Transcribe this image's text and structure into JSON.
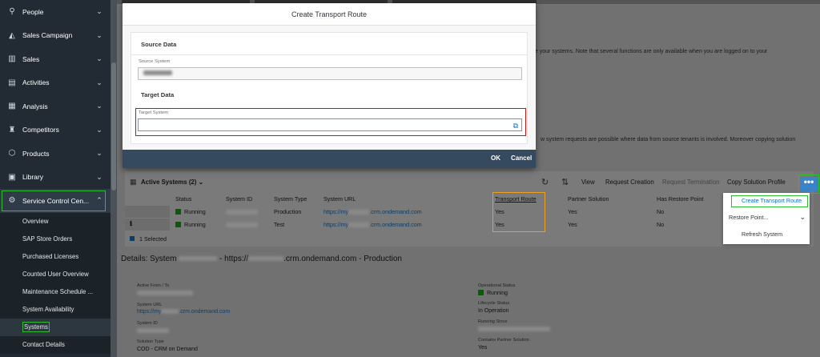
{
  "sidebar": {
    "items": [
      {
        "label": "People",
        "icon": "person-icon",
        "glyph": "⚲"
      },
      {
        "label": "Sales Campaign",
        "icon": "megaphone-icon",
        "glyph": "◭"
      },
      {
        "label": "Sales",
        "icon": "sales-chart-icon",
        "glyph": "▥"
      },
      {
        "label": "Activities",
        "icon": "activities-icon",
        "glyph": "▤"
      },
      {
        "label": "Analysis",
        "icon": "analysis-icon",
        "glyph": "▦"
      },
      {
        "label": "Competitors",
        "icon": "competitors-icon",
        "glyph": "♜"
      },
      {
        "label": "Products",
        "icon": "products-icon",
        "glyph": "⬡"
      },
      {
        "label": "Library",
        "icon": "library-icon",
        "glyph": "▣"
      },
      {
        "label": "Service Control Cen...",
        "icon": "service-control-icon",
        "glyph": "⚙"
      }
    ],
    "sub_items": [
      "Overview",
      "SAP Store Orders",
      "Purchased Licenses",
      "Counted User Overview",
      "Maintenance Schedule ...",
      "System Availability",
      "Systems",
      "Contact Details"
    ]
  },
  "background": {
    "text_line_1": "ge your systems. Note that several functions are only available when you are logged on to your",
    "text_line_2": "w system requests are possible where data from source tenants is involved. Moreover copying solution"
  },
  "dialog": {
    "title": "Create Transport Route",
    "source_section": "Source Data",
    "source_label": "Source System",
    "source_value": "TNCKPRBL",
    "target_section": "Target Data",
    "target_label": "Target System",
    "target_value": "",
    "ok_label": "OK",
    "cancel_label": "Cancel"
  },
  "table": {
    "title": "Active Systems",
    "count": "(2)",
    "toolbar": {
      "view": "View",
      "request_creation": "Request Creation",
      "request_termination": "Request Termination",
      "copy_solution_profile": "Copy Solution Profile",
      "more": "•••"
    },
    "columns": [
      "Status",
      "System ID",
      "System Type",
      "System URL",
      "Transport Route",
      "Partner Solution",
      "Has Restore Point"
    ],
    "rows": [
      {
        "status": "Running",
        "system_type": "Production",
        "url_prefix": "https://my",
        "url_suffix": ".crm.ondemand.com",
        "transport_route": "Yes",
        "partner_solution": "Yes",
        "restore_point": "No"
      },
      {
        "status": "Running",
        "system_type": "Test",
        "url_prefix": "https://my",
        "url_suffix": ".crm.ondemand.com",
        "transport_route": "Yes",
        "partner_solution": "Yes",
        "restore_point": "No"
      }
    ],
    "selected_count": "1 Selected"
  },
  "context_menu": {
    "create_transport_route": "Create Transport Route",
    "restore_point": "Restore Point...",
    "refresh_system": "Refresh System"
  },
  "details": {
    "title_prefix": "Details: System",
    "title_mid": "- https://",
    "title_suffix": ".crm.ondemand.com - Production",
    "active_from_label": "Active From / To",
    "system_url_label": "System URL",
    "system_url_prefix": "https://my",
    "system_url_suffix": ".crm.ondemand.com",
    "system_id_label": "System ID",
    "solution_type_label": "Solution Type",
    "solution_type_value": "COD - CRM on Demand",
    "operational_status_label": "Operational Status",
    "operational_status_value": "Running",
    "lifecycle_status_label": "Lifecycle Status",
    "lifecycle_status_value": "In Operation",
    "running_since_label": "Running Since",
    "contains_partner_label": "Contains Partner Solution",
    "contains_partner_value": "Yes"
  },
  "colors": {
    "highlight_green": "#2dbd2d",
    "highlight_red": "#d01010",
    "highlight_orange": "#f0a020",
    "dialog_footer": "#354a5f",
    "accent_blue": "#0a6ed1"
  }
}
